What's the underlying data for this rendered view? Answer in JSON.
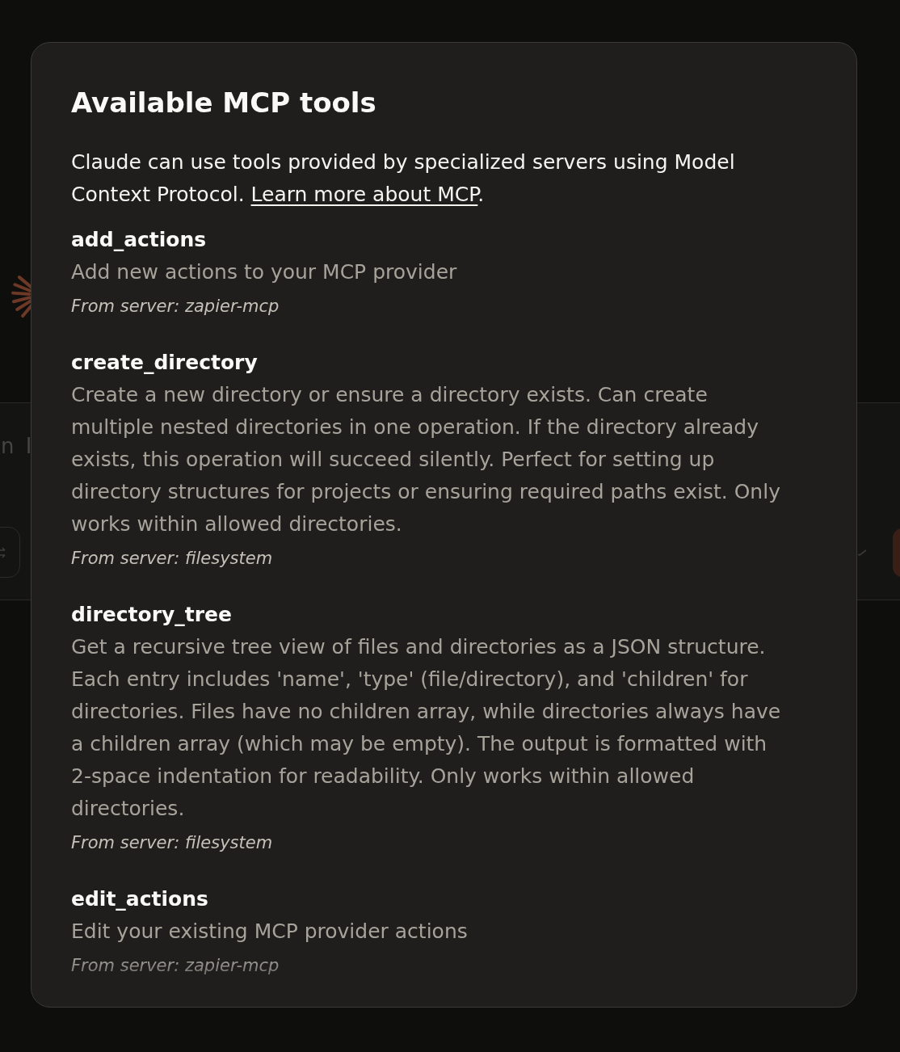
{
  "background": {
    "input_text": "n I"
  },
  "dialog": {
    "title": "Available MCP tools",
    "intro": "Claude can use tools provided by specialized servers using Model Context Protocol.",
    "link": "Learn more about MCP",
    "after_link": "."
  },
  "tools": [
    {
      "name": "add_actions",
      "description": "Add new actions to your MCP provider",
      "server": "From server: zapier-mcp"
    },
    {
      "name": "create_directory",
      "description": "Create a new directory or ensure a directory exists. Can create multiple nested directories in one operation. If the directory already exists, this operation will succeed silently. Perfect for setting up directory structures for projects or ensuring required paths exist. Only works within allowed directories.",
      "server": "From server: filesystem"
    },
    {
      "name": "directory_tree",
      "description": "Get a recursive tree view of files and directories as a JSON structure. Each entry includes 'name', 'type' (file/directory), and 'children' for directories. Files have no children array, while directories always have a children array (which may be empty). The output is formatted with 2-space indentation for readability. Only works within allowed directories.",
      "server": "From server: filesystem"
    },
    {
      "name": "edit_actions",
      "description": "Edit your existing MCP provider actions",
      "server": "From server: zapier-mcp"
    }
  ]
}
